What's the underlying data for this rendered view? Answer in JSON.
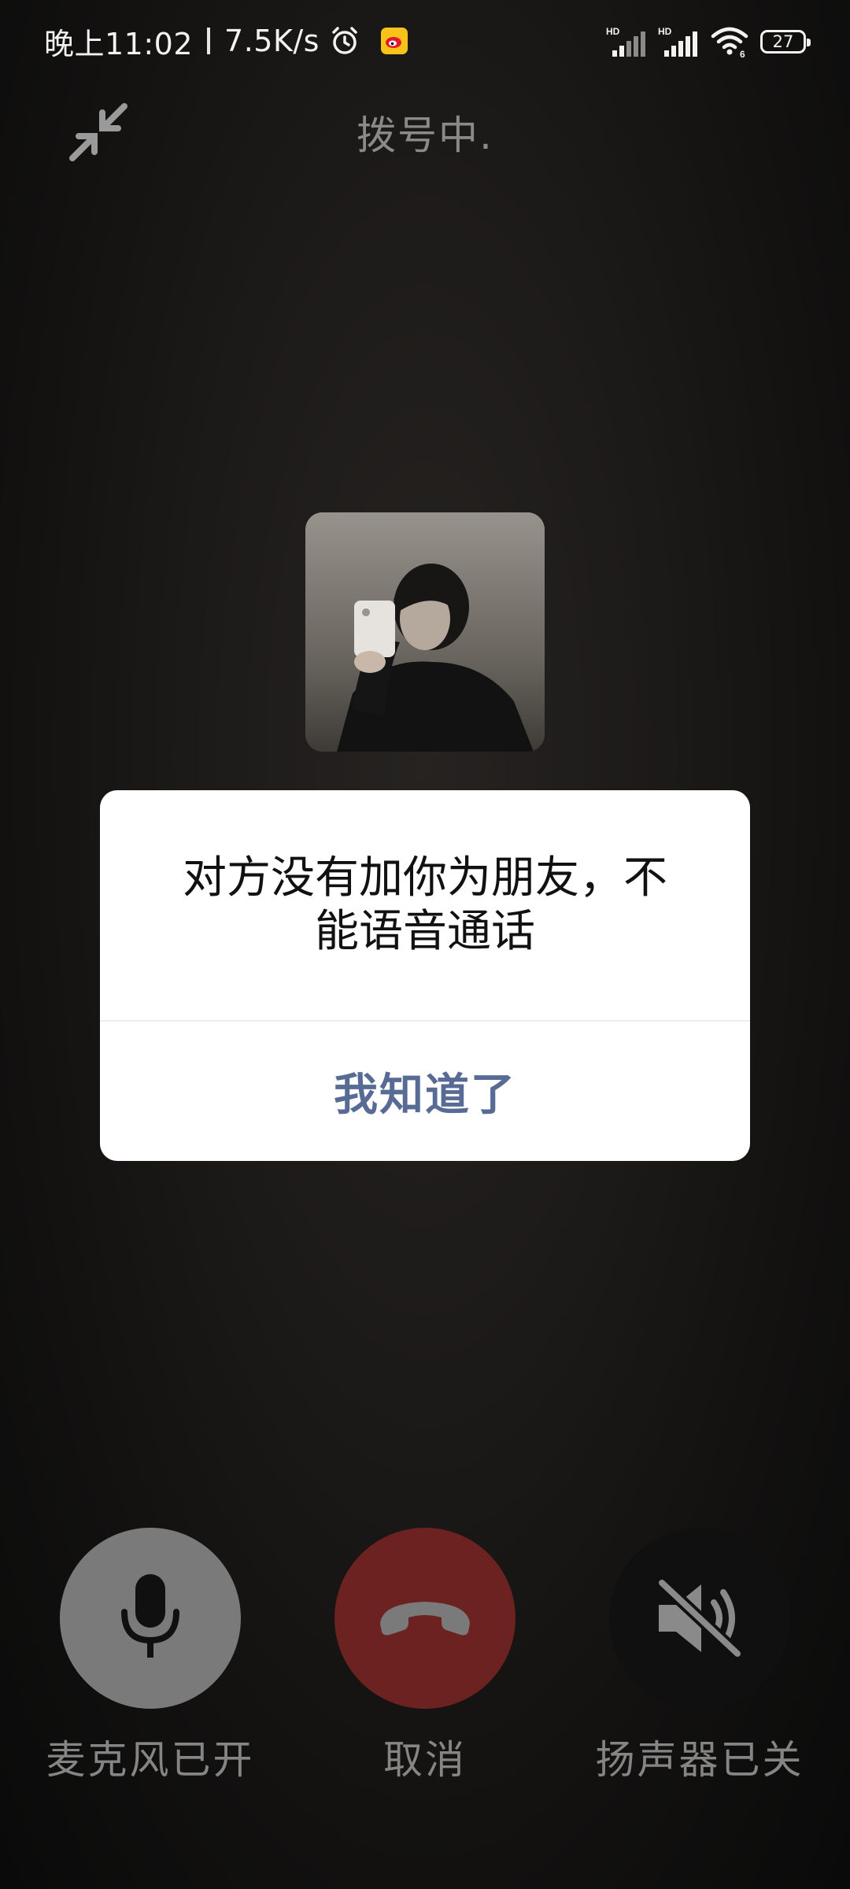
{
  "status_bar": {
    "time": "晚上11:02",
    "net_speed": "7.5K/s",
    "battery": "27",
    "icons": [
      "alarm-icon",
      "weibo-icon",
      "hd-signal-icon",
      "hd-signal-icon",
      "wifi-icon",
      "battery-icon"
    ]
  },
  "header": {
    "call_status": "拨号中.",
    "minimize_icon": "minimize-arrows-icon"
  },
  "dialog": {
    "message_line1": "对方没有加你为朋友，不",
    "message_line2": "能语音通话",
    "confirm_label": "我知道了",
    "confirm_color": "#576b95"
  },
  "controls": {
    "mic": {
      "label": "麦克风已开",
      "icon": "microphone-icon"
    },
    "hangup": {
      "label": "取消",
      "icon": "hang-up-icon",
      "color": "#6b2220"
    },
    "speaker": {
      "label": "扬声器已关",
      "icon": "speaker-muted-icon"
    }
  }
}
